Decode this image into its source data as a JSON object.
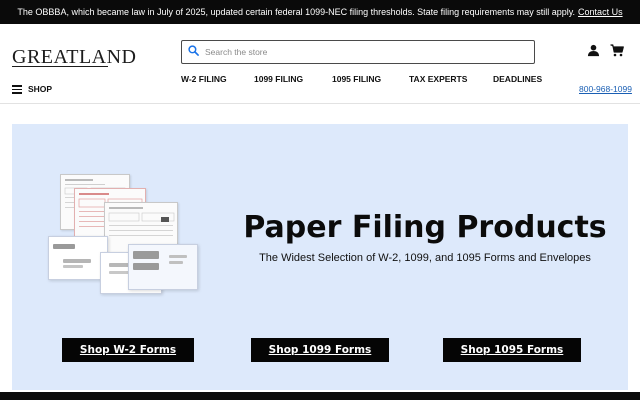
{
  "announcement": {
    "text": "The OBBBA, which became law in July of 2025, updated certain federal 1099-NEC filing thresholds. State filing requirements may still apply.",
    "link": "Contact Us"
  },
  "header": {
    "logo_text": "GREATLAND",
    "search_placeholder": "Search the store",
    "shop_label": "SHOP",
    "phone": "800-968-1099",
    "nav": [
      "W-2 FILING",
      "1099 FILING",
      "1095 FILING",
      "TAX EXPERTS",
      "DEADLINES"
    ]
  },
  "hero": {
    "title": "Paper Filing Products",
    "subtitle": "The Widest Selection of W-2, 1099, and 1095 Forms and Envelopes",
    "buttons": [
      "Shop W-2 Forms",
      "Shop 1099 Forms",
      "Shop 1095 Forms"
    ]
  },
  "icons": {
    "search": "search-icon",
    "user": "user-icon",
    "cart": "cart-icon",
    "menu": "hamburger-menu-icon"
  },
  "colors": {
    "announcement_bg": "#0a0a0a",
    "hero_bg": "#dde9fb",
    "cta_bg": "#050505",
    "phone_link": "#1a5fb4",
    "search_icon": "#1a73e8"
  }
}
